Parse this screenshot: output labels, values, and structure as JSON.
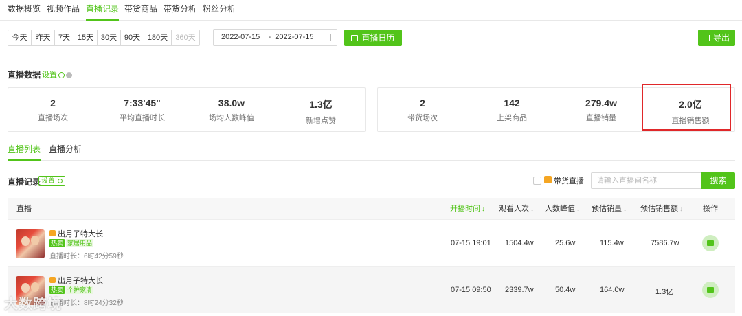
{
  "top_tabs": [
    "数据概览",
    "视频作品",
    "直播记录",
    "带货商品",
    "带货分析",
    "粉丝分析"
  ],
  "date_ranges": [
    "今天",
    "昨天",
    "7天",
    "15天",
    "30天",
    "90天",
    "180天",
    "360天"
  ],
  "date_range_value": "2022-07-15    -  2022-07-15",
  "calendar_button": "直播日历",
  "export_button": "导出",
  "live_data": {
    "title": "直播数据",
    "setting": "设置",
    "stats_left": [
      {
        "value": "2",
        "label": "直播场次"
      },
      {
        "value": "7:33'45\"",
        "label": "平均直播时长"
      },
      {
        "value": "38.0w",
        "label": "场均人数峰值"
      },
      {
        "value": "1.3亿",
        "label": "新增点赞"
      }
    ],
    "stats_right": [
      {
        "value": "2",
        "label": "带货场次"
      },
      {
        "value": "142",
        "label": "上架商品"
      },
      {
        "value": "279.4w",
        "label": "直播销量"
      },
      {
        "value": "2.0亿",
        "label": "直播销售额"
      }
    ]
  },
  "sub_tabs": [
    "直播列表",
    "直播分析"
  ],
  "records": {
    "title": "直播记录",
    "setting": "设置",
    "goods_live_label": "带货直播",
    "search_placeholder": "请输入直播间名称",
    "search_button": "搜索",
    "columns": [
      "直播",
      "开播时间",
      "观看人次",
      "人数峰值",
      "预估销量",
      "预估销售额",
      "操作"
    ],
    "rows": [
      {
        "name": "出月子特大长",
        "hot": "热卖",
        "category": "家居用品",
        "duration": "直播时长：6时42分59秒",
        "start": "07-15 19:01",
        "views": "1504.4w",
        "peak": "25.6w",
        "sales": "115.4w",
        "revenue": "7586.7w"
      },
      {
        "name": "出月子特大长",
        "hot": "热卖",
        "category": "个护家清",
        "duration": "直播时长：8时24分32秒",
        "start": "07-15 09:50",
        "views": "2339.7w",
        "peak": "50.4w",
        "sales": "164.0w",
        "revenue": "1.3亿"
      }
    ]
  },
  "watermark": "大数跨境"
}
